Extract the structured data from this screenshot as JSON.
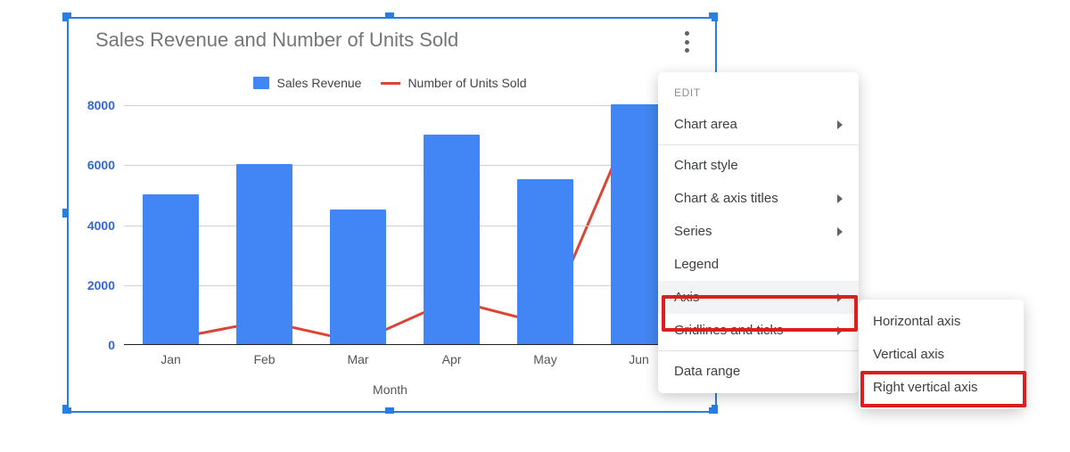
{
  "chart_data": {
    "type": "bar+line",
    "title": "Sales Revenue and Number of Units Sold",
    "xlabel": "Month",
    "ylabel": "",
    "ylim": [
      0,
      8000
    ],
    "yticks": [
      0,
      2000,
      4000,
      6000,
      8000
    ],
    "categories": [
      "Jan",
      "Feb",
      "Mar",
      "Apr",
      "May",
      "Jun"
    ],
    "series": [
      {
        "name": "Sales Revenue",
        "type": "bar",
        "values": [
          5000,
          6000,
          4500,
          7000,
          5500,
          8000
        ]
      },
      {
        "name": "Number of Units Sold",
        "type": "line",
        "values": [
          200,
          800,
          100,
          1500,
          700,
          8000
        ]
      }
    ]
  },
  "legend": {
    "s0": "Sales Revenue",
    "s1": "Number of Units Sold"
  },
  "menu": {
    "header": "EDIT",
    "chart_area": "Chart area",
    "chart_style": "Chart style",
    "axis_titles": "Chart & axis titles",
    "series": "Series",
    "legend": "Legend",
    "axis": "Axis",
    "gridlines": "Gridlines and ticks",
    "data_range": "Data range"
  },
  "submenu": {
    "horizontal": "Horizontal axis",
    "vertical": "Vertical axis",
    "right_vertical": "Right vertical axis"
  }
}
